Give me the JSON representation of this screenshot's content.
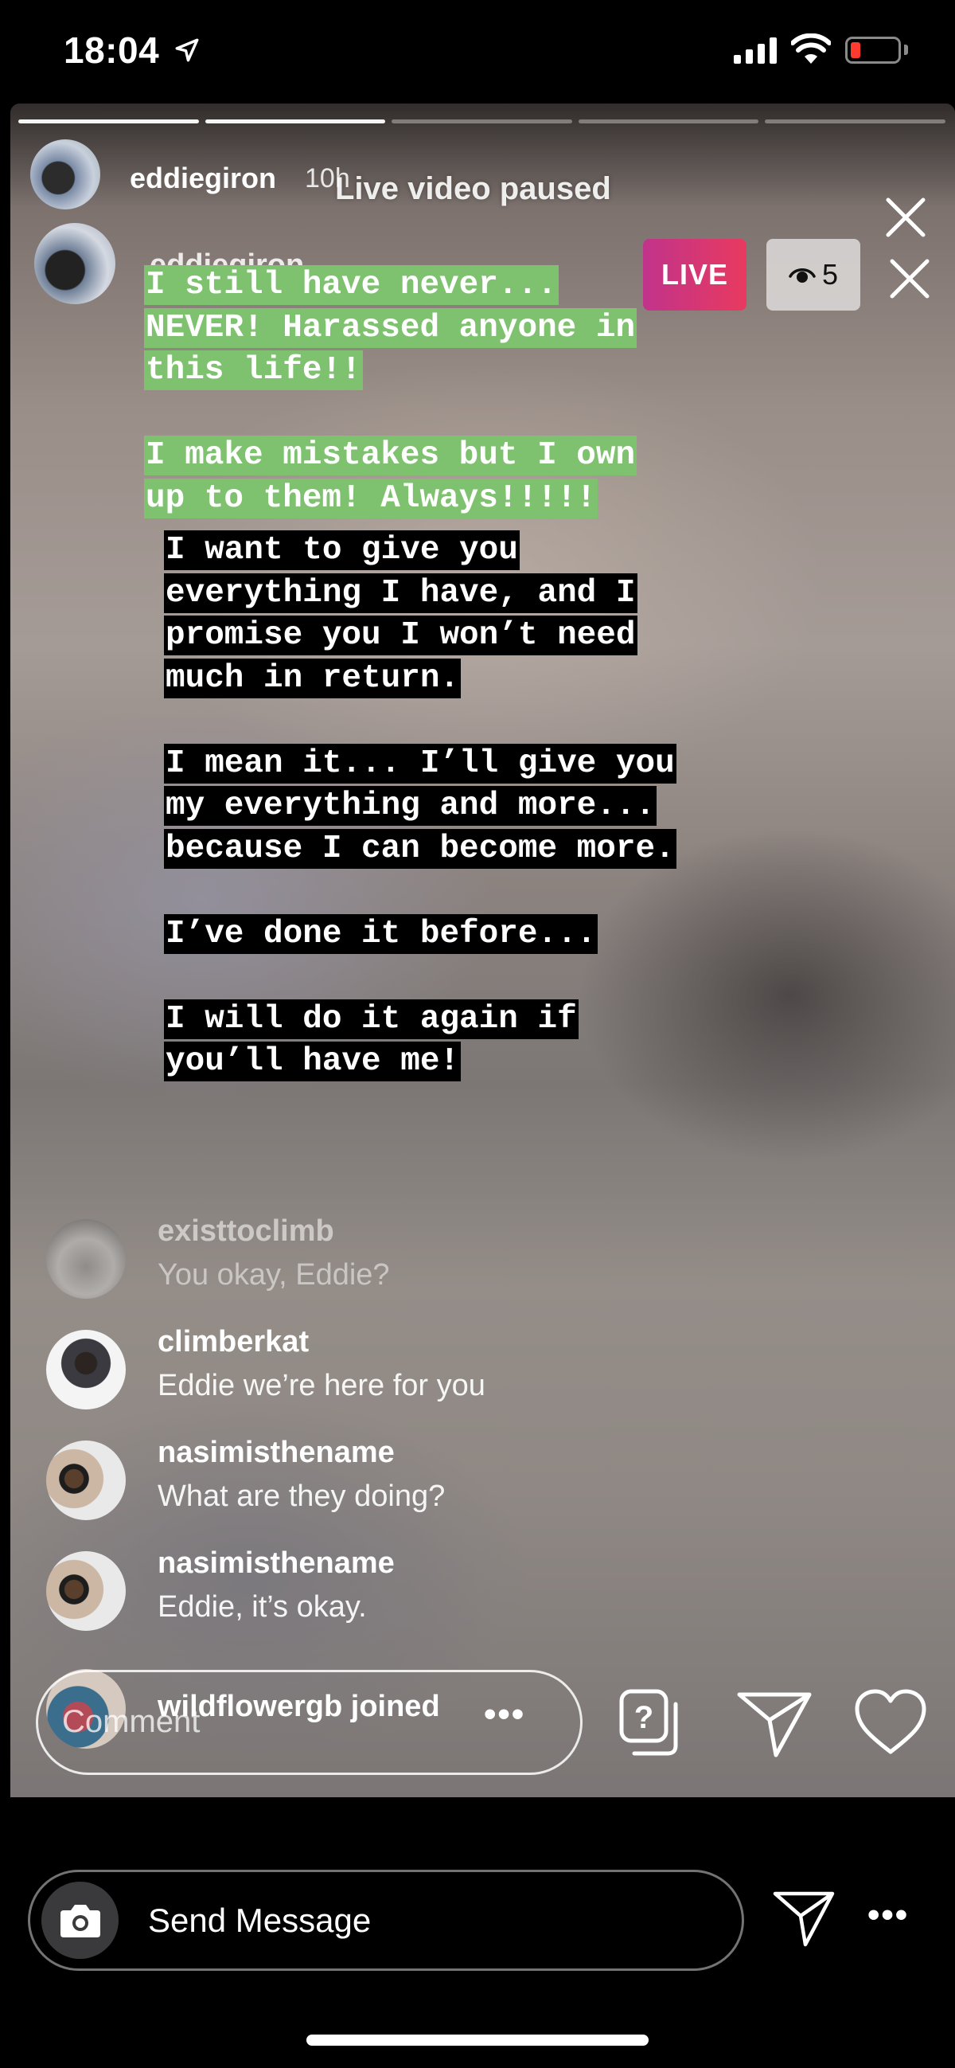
{
  "status_bar": {
    "time": "18:04"
  },
  "story": {
    "progress_segments": [
      {
        "state": "done"
      },
      {
        "state": "done"
      },
      {
        "state": "pending"
      },
      {
        "state": "pending"
      },
      {
        "state": "pending"
      }
    ],
    "outer_header": {
      "username": "eddiegiron",
      "time_ago": "10h",
      "paused_label": "Live video paused"
    },
    "inner_header": {
      "username": "eddiegiron",
      "live_label": "LIVE",
      "viewer_count": "5"
    },
    "green_text_lines": [
      "I still have never...",
      "NEVER! Harassed anyone in",
      "this life!!",
      "",
      "I make mistakes but I own",
      "up to them! Always!!!!!"
    ],
    "black_text_lines": [
      "I want to give you",
      "everything I have, and I",
      "promise you I won’t need",
      "much in return.",
      "",
      "I mean it... I’ll give you",
      "my everything and more...",
      "because I can become more.",
      "",
      "I’ve done it before...",
      "",
      "I will do it again if",
      "you’ll have me!"
    ],
    "comments": [
      {
        "username": "existtoclimb",
        "message": "You okay, Eddie?",
        "avatar": "rock-photo"
      },
      {
        "username": "climberkat",
        "message": "Eddie we’re here for you",
        "avatar": "person-photo"
      },
      {
        "username": "nasimisthename",
        "message": "What are they doing?",
        "avatar": "couple-photo"
      },
      {
        "username": "nasimisthename",
        "message": "Eddie, it’s okay.",
        "avatar": "couple-photo"
      },
      {
        "username": "wildflowergb joined",
        "message": "",
        "avatar": "group-photo"
      }
    ],
    "comment_input": {
      "placeholder": "Comment",
      "more_label": "•••"
    }
  },
  "message_bar": {
    "placeholder": "Send Message",
    "more_label": "•••"
  },
  "icons": {
    "location": "location-arrow-icon",
    "signal": "cellular-signal-icon",
    "wifi": "wifi-icon",
    "battery": "battery-low-icon",
    "close": "close-icon",
    "eye": "eye-icon",
    "questions": "question-box-icon",
    "share": "paper-plane-icon",
    "like": "heart-icon",
    "camera": "camera-icon"
  },
  "colors": {
    "live_badge_start": "#c1338b",
    "live_badge_end": "#e83a5f",
    "green_highlight": "#7ec26f",
    "black_highlight": "#000000",
    "battery_low": "#ff3b30"
  }
}
